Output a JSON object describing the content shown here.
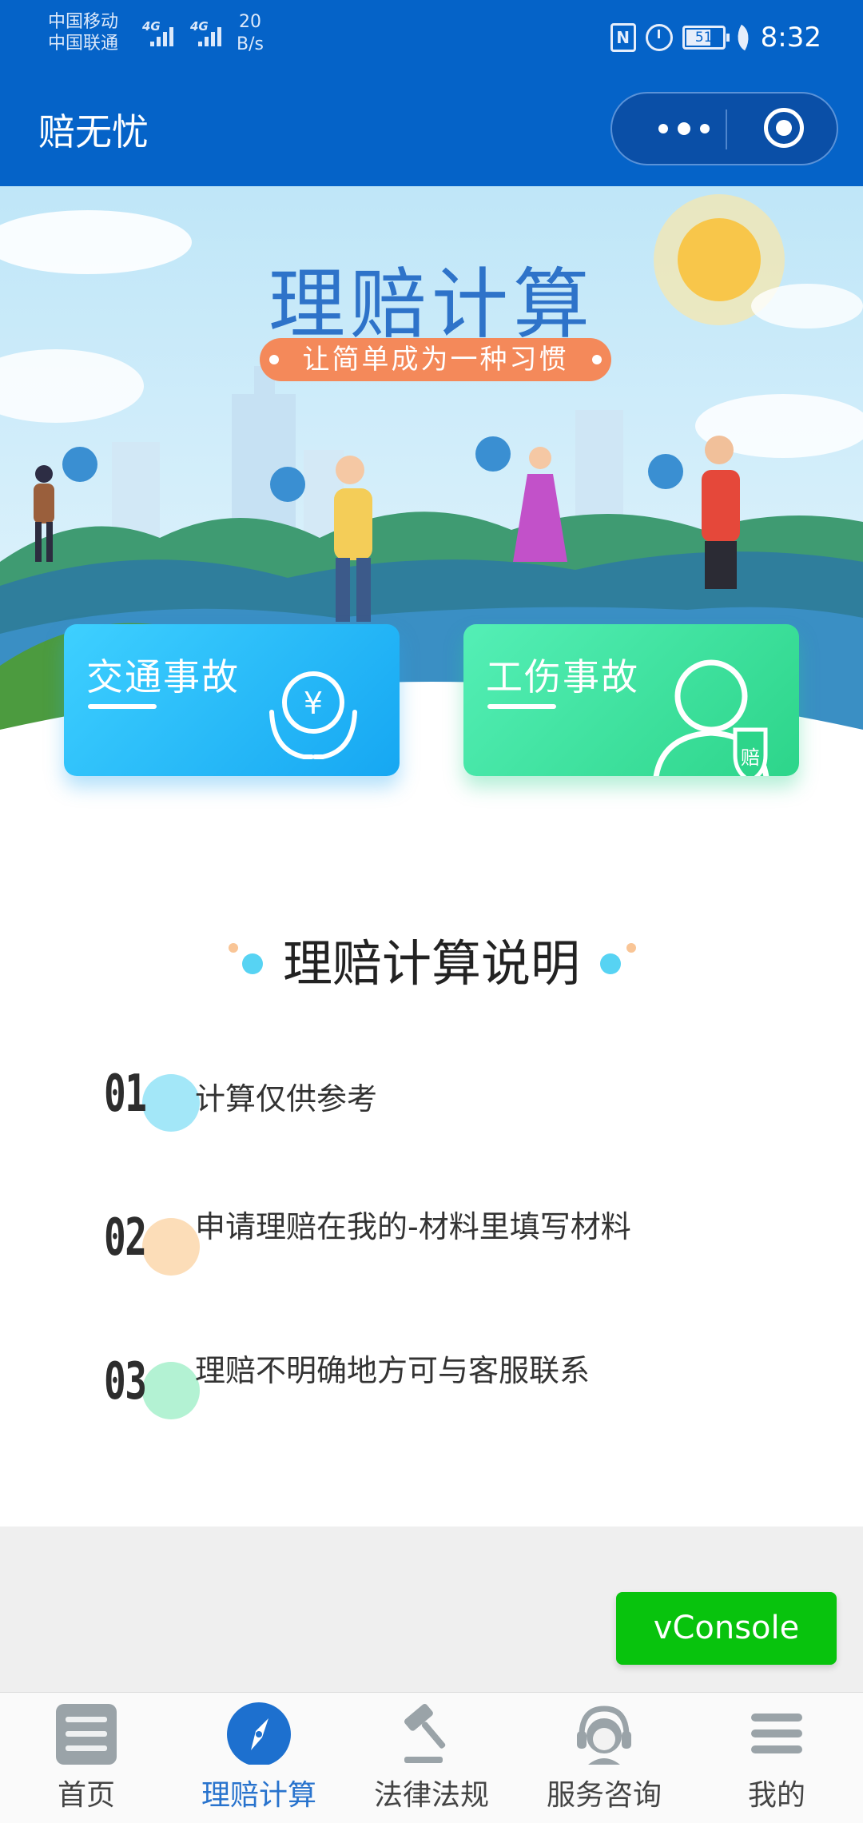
{
  "status_bar": {
    "carrier_1": "中国移动",
    "carrier_2": "中国联通",
    "network_1": "4G",
    "network_2": "4G",
    "speed_value": "20",
    "speed_unit": "B/s",
    "battery": "51",
    "time": "8:32"
  },
  "header": {
    "title": "赔无忧",
    "more_icon": "more-dots-icon",
    "close_icon": "target-circle-icon"
  },
  "banner": {
    "title": "理赔计算",
    "slogan": "让简单成为一种习惯",
    "cards": [
      {
        "label": "交通事故",
        "icon": "yen-coin-hands-icon",
        "color": "#16a7f2"
      },
      {
        "label": "工伤事故",
        "icon": "person-claim-badge-icon",
        "badge_text": "赔",
        "color": "#2dd58a"
      }
    ]
  },
  "instructions": {
    "title": "理赔计算说明",
    "steps": [
      {
        "number": "01",
        "text": "计算仅供参考",
        "color": "#57d3f3"
      },
      {
        "number": "02",
        "text": "申请理赔在我的-材料里填写材料",
        "color": "#fbcf9a"
      },
      {
        "number": "03",
        "text": "理赔不明确地方可与客服联系",
        "color": "#93ecc0"
      }
    ]
  },
  "vconsole": {
    "label": "vConsole",
    "color": "#08c30d"
  },
  "tabbar": {
    "active_color": "#2873cd",
    "items": [
      {
        "label": "首页",
        "icon": "home-list-icon"
      },
      {
        "label": "理赔计算",
        "icon": "compass-icon"
      },
      {
        "label": "法律法规",
        "icon": "gavel-icon"
      },
      {
        "label": "服务咨询",
        "icon": "headset-agent-icon"
      },
      {
        "label": "我的",
        "icon": "menu-lines-icon"
      }
    ]
  }
}
